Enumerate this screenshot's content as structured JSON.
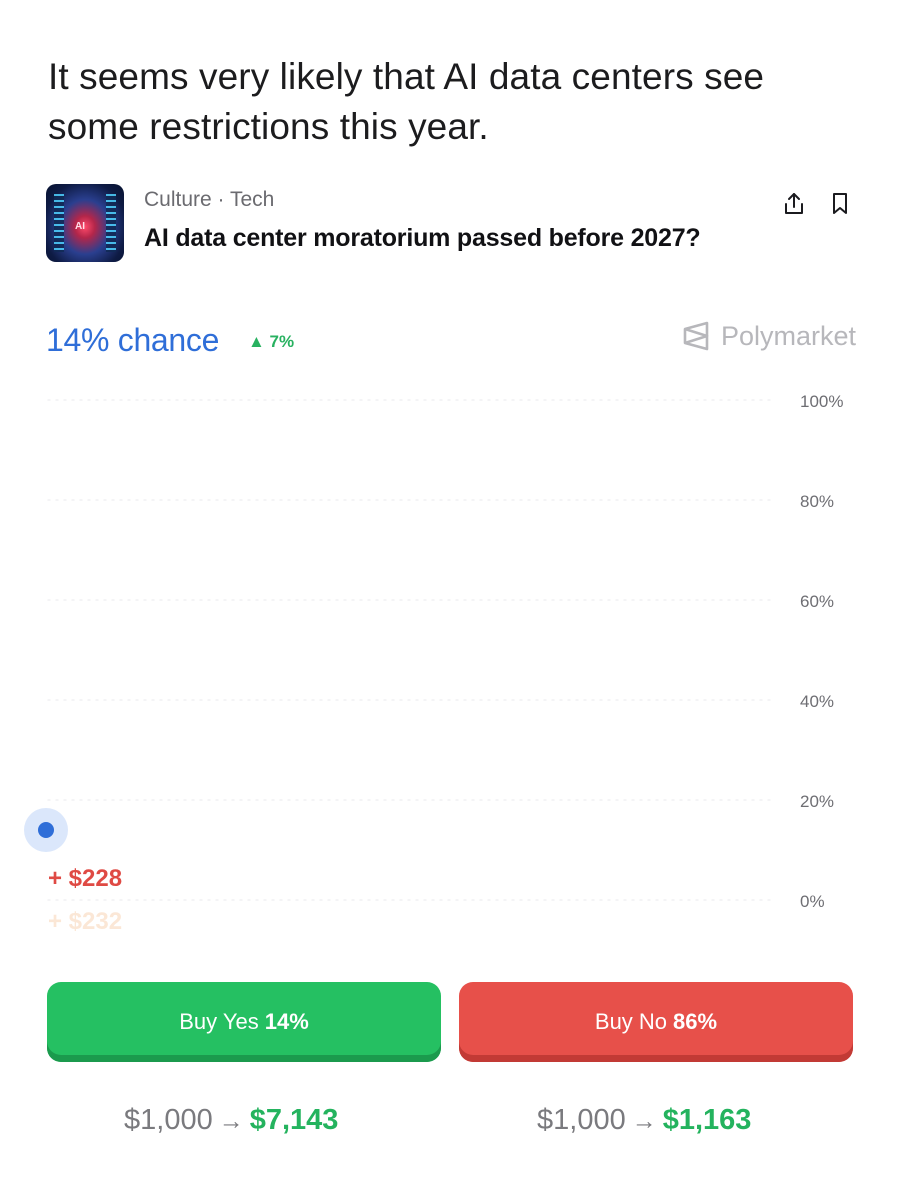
{
  "headline": "It seems very likely that AI data centers see some restrictions this year.",
  "market": {
    "thumbnail_icon": "data-center-image",
    "thumbnail_text": "AI",
    "category": "Culture · Tech",
    "title": "AI data center moratorium passed before 2027?",
    "actions": [
      "share-icon",
      "bookmark-icon"
    ]
  },
  "stats": {
    "chance": "14% chance",
    "delta": "▲ 7%",
    "brand": "Polymarket",
    "brand_icon": "polymarket-logo-icon"
  },
  "chart_data": {
    "type": "line",
    "x": [
      0
    ],
    "series": [
      {
        "values": [
          14
        ]
      }
    ],
    "y_ticks": [
      "100%",
      "80%",
      "60%",
      "40%",
      "20%",
      "0%"
    ],
    "ylim": [
      0,
      100
    ],
    "grid": true,
    "annotations": [
      "+ $228",
      "+ $232"
    ]
  },
  "buttons": {
    "yes": {
      "label": "Buy Yes",
      "value": "14%"
    },
    "no": {
      "label": "Buy No",
      "value": "86%"
    }
  },
  "payouts": {
    "yes": {
      "stake": "$1,000",
      "arrow": "→",
      "return": "$7,143"
    },
    "no": {
      "stake": "$1,000",
      "arrow": "→",
      "return": "$1,163"
    }
  },
  "colors": {
    "yes": "#25c062",
    "no": "#e7504a",
    "chance": "#2f6ed8",
    "brand": "#b7b7bb"
  }
}
